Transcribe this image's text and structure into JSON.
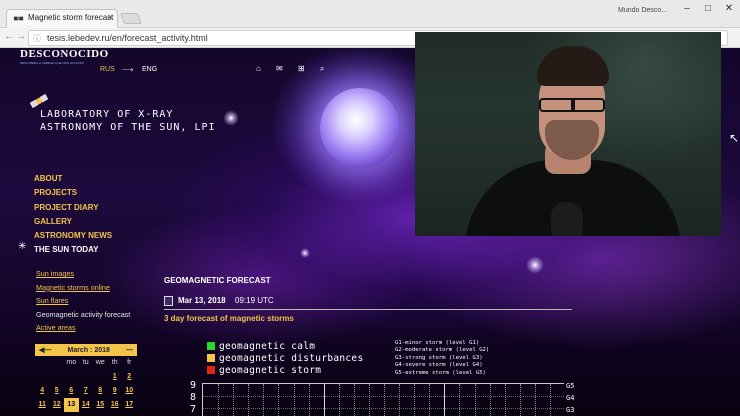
{
  "browser": {
    "tab_title": "Magnetic storm forecast",
    "tab_close": "×",
    "profile_name": "Mundo Desco...",
    "window_controls": [
      "–",
      "□",
      "✕"
    ],
    "back": "←",
    "forward": "→",
    "reload": "C",
    "url": "tesis.lebedev.ru/en/forecast_activity.html"
  },
  "site": {
    "logo": "DESCONOCIDO",
    "logo_tagline": "DESCUBRE LA VERDAD QUE NOS OCULTAN",
    "lang_ru": "RUS",
    "lang_arrow": "⟶",
    "lang_en": "ENG",
    "top_icons": [
      "⌂",
      "✉",
      "⊞",
      "⌕"
    ],
    "lab_title_line1": "LABORATORY OF X-RAY",
    "lab_title_line2": "ASTRONOMY OF THE SUN, LPI"
  },
  "menu": {
    "items": [
      {
        "label": "ABOUT"
      },
      {
        "label": "PROJECTS"
      },
      {
        "label": "PROJECT DIARY"
      },
      {
        "label": "GALLERY"
      },
      {
        "label": "ASTRONOMY NEWS"
      },
      {
        "label": "THE SUN TODAY"
      }
    ],
    "active_mark": "✳"
  },
  "sublinks": [
    {
      "label": "Sun images"
    },
    {
      "label": "Magnetic storms online"
    },
    {
      "label": "Sun flares"
    },
    {
      "label": "Geomagnetic activity forecast"
    },
    {
      "label": "Active areas"
    }
  ],
  "calendar": {
    "prev": "◀—",
    "month": "March : 2018",
    "next": "—",
    "weekdays": [
      "",
      "",
      "mo",
      "tu",
      "we",
      "th",
      "fr"
    ],
    "rows": [
      [
        "",
        "",
        "",
        "",
        "",
        "1",
        "2"
      ],
      [
        "4",
        "5",
        "6",
        "7",
        "8",
        "9",
        "10"
      ],
      [
        "11",
        "12",
        "13",
        "14",
        "15",
        "16",
        "17"
      ]
    ],
    "today": "13"
  },
  "forecast": {
    "heading": "GEOMAGNETIC FORECAST",
    "date": "Mar 13, 2018",
    "time": "09:19 UTC",
    "subtitle": "3 day forecast of magnetic storms",
    "legend": [
      {
        "label": "geomagnetic calm",
        "color": "#2bd62b"
      },
      {
        "label": "geomagnetic disturbances",
        "color": "#f2c44a"
      },
      {
        "label": "geomagnetic storm",
        "color": "#e0261a"
      }
    ],
    "storm_levels": [
      "G1-minor storm (level G1)",
      "G2-moderate storm (level G2)",
      "G3-strong storm (level G3)",
      "G4-severe storm (level G4)",
      "G5-extreme storm (level G5)"
    ],
    "y_ticks": [
      "9",
      "8",
      "7"
    ],
    "g_ticks": [
      "G5",
      "G4",
      "G3"
    ]
  },
  "colors": {
    "accent": "#f2c44a",
    "calm": "#2bd62b",
    "storm": "#e0261a"
  }
}
